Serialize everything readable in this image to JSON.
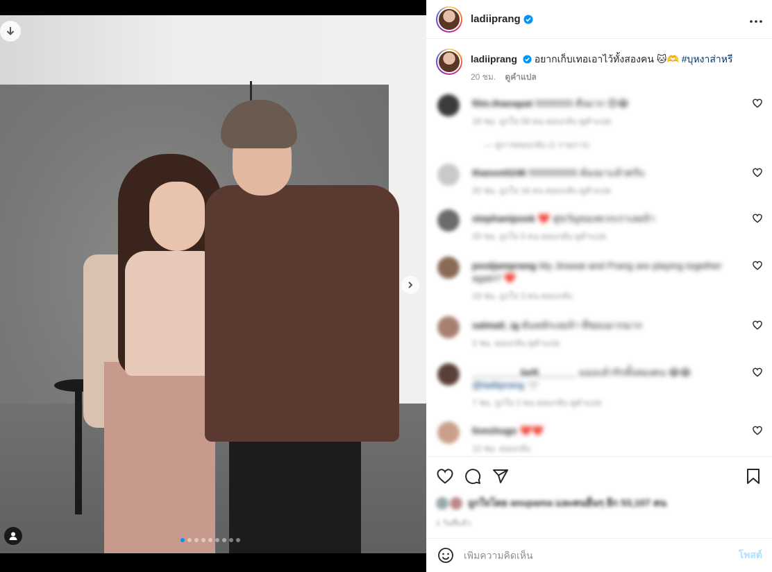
{
  "post": {
    "username": "ladiiprang",
    "more_icon": "more-horizontal-icon"
  },
  "caption": {
    "username": "ladiiprang",
    "text": "อยากเก็บเทอเอาไว้ทั้งสองคน 🐱🫶",
    "hashtag": "#บุหงาส่าหรี",
    "time": "20 ชม.",
    "see_translation": "ดูคำแปล"
  },
  "comments": [
    {
      "username": "film.thanapat",
      "text": "5555555 ตึงมาก 😍😂",
      "meta": "19 ชม.   ถูกใจ 58 คน   ตอบกลับ   ดูคำแปล",
      "reply": "—   ดูการตอบกลับ (1 รายการ)",
      "avatar_color": "#3b3b3b"
    },
    {
      "username": "thanon0246",
      "text": "555555555 ต้องมาแล้วครับ",
      "meta": "20 ชม.   ถูกใจ 16 คน   ตอบกลับ   ดูคำแปล",
      "reply": "",
      "avatar_color": "#c9c9c9"
    },
    {
      "username": "stephanipook",
      "text": "❤️ คู่ขวัญของพวกเราเลยจ้า",
      "meta": "20 ชม.   ถูกใจ 5 คน   ตอบกลับ   ดูคำแปล",
      "reply": "",
      "avatar_color": "#6b6b6b"
    },
    {
      "username": "pooljamprang",
      "text": "My Jirawat and Prang are playing together again? ❤️",
      "meta": "19 ชม.   ถูกใจ 3 คน   ตอบกลับ",
      "reply": "",
      "avatar_color": "#8a6a55"
    },
    {
      "username": "salmali_ig",
      "text": "ต้นหลักเลยจ้า ที่ชอบมากมาก",
      "meta": "3 ชม.   ตอบกลับ   ดูคำแปล",
      "reply": "",
      "avatar_color": "#a88070"
    },
    {
      "username": "_________beft_______",
      "text": "มองแล้วรักทั้งสองคน 😂😂",
      "meta": "7 ชม.   ถูกใจ 2 คน   ตอบกลับ   ดูคำแปล",
      "reply": "",
      "avatar_color": "#5a4038",
      "mention": "@ladiiprang 🤍"
    },
    {
      "username": "liveshugs",
      "text": "❤️❤️",
      "meta": "12 ชม.   ตอบกลับ",
      "reply": "",
      "avatar_color": "#caa08a"
    }
  ],
  "actions": {
    "likes_text": "ถูกใจโดย anupama และคนอื่นๆ อีก 53,107 คน",
    "date": "1 วันที่แล้ว",
    "add_comment_placeholder": "เพิ่มความคิดเห็น",
    "post_label": "โพสต์"
  },
  "carousel": {
    "slide_count": 9,
    "active_index": 0
  },
  "colors": {
    "verified": "#0095f6",
    "hashtag": "#00376b",
    "post_disabled": "#b2dffc"
  }
}
